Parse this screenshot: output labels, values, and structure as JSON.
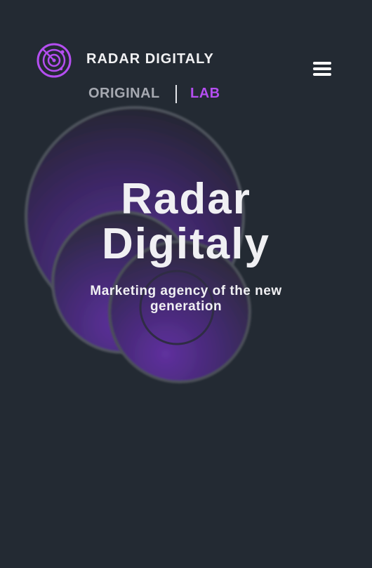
{
  "header": {
    "brand_name": "RADAR DIGITALY",
    "logo_icon": "radar-logo-icon",
    "menu_icon": "hamburger-menu-icon"
  },
  "mode_switch": {
    "original_label": "ORIGINAL",
    "lab_label": "LAB",
    "active": "LAB"
  },
  "hero": {
    "title_line1": "Radar",
    "title_line2": "Digitaly",
    "subtitle": "Marketing agency of the new generation"
  },
  "colors": {
    "background": "#232a33",
    "accent": "#b44ef0",
    "inactive_text": "#a6a9b1",
    "text": "#f0f0f3"
  }
}
